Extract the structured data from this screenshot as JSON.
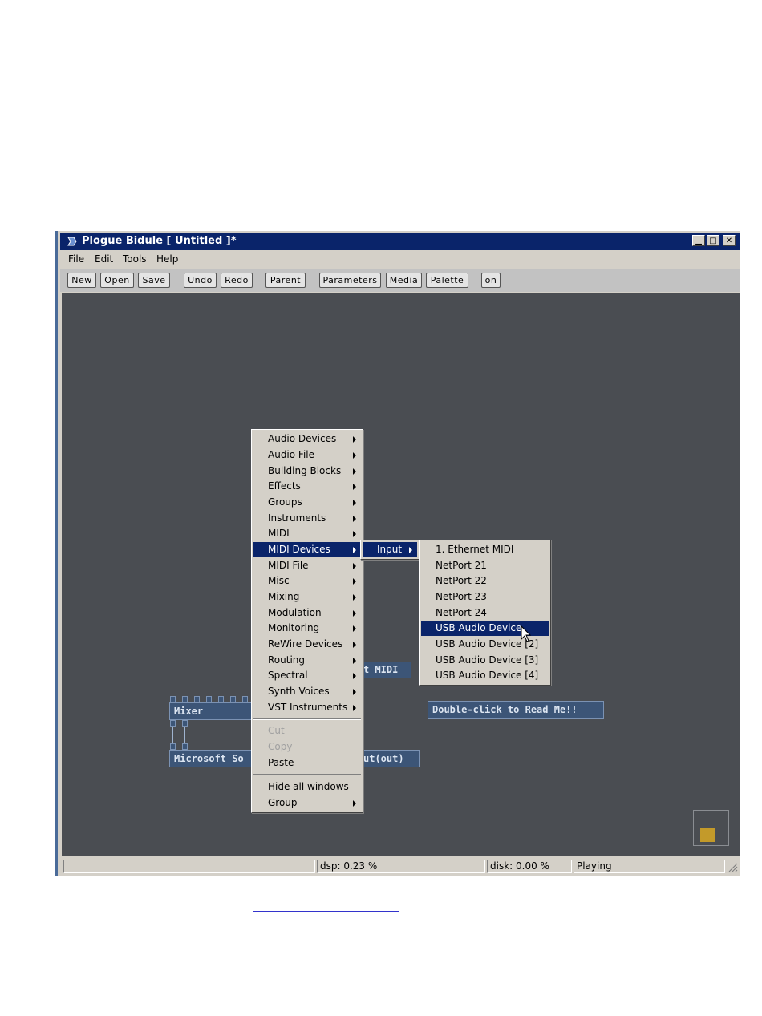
{
  "window": {
    "title": "Plogue Bidule [ Untitled ]*"
  },
  "menubar": [
    "File",
    "Edit",
    "Tools",
    "Help"
  ],
  "toolbar": [
    "New",
    "Open",
    "Save",
    "Undo",
    "Redo",
    "Parent",
    "Parameters",
    "Media",
    "Palette",
    "on"
  ],
  "canvas": {
    "nodes": {
      "midi_partial": "t MIDI",
      "readme": "Double-click to Read Me!!",
      "mixer": "Mixer",
      "ms_sound": "Microsoft So",
      "out_partial": "ut(out)"
    }
  },
  "context_menu": {
    "items": [
      "Audio Devices",
      "Audio File",
      "Building Blocks",
      "Effects",
      "Groups",
      "Instruments",
      "MIDI",
      "MIDI Devices",
      "MIDI File",
      "Misc",
      "Mixing",
      "Modulation",
      "Monitoring",
      "ReWire Devices",
      "Routing",
      "Spectral",
      "Synth Voices",
      "VST Instruments"
    ],
    "selected": "MIDI Devices",
    "edit_items": [
      "Cut",
      "Copy",
      "Paste"
    ],
    "extra_items": [
      "Hide all windows",
      "Group"
    ]
  },
  "submenu": {
    "items": [
      "Input"
    ]
  },
  "subsubmenu": {
    "items": [
      "1. Ethernet MIDI",
      "NetPort 21",
      "NetPort 22",
      "NetPort 23",
      "NetPort 24",
      "USB Audio Device",
      "USB Audio Device [2]",
      "USB Audio Device [3]",
      "USB Audio Device [4]"
    ],
    "selected": "USB Audio Device"
  },
  "statusbar": {
    "dsp": "dsp:  0.23 %",
    "disk": "disk:  0.00 %",
    "state": "Playing"
  },
  "colors": {
    "title_bg": "#0a246a",
    "canvas_bg": "#4a4d52",
    "highlight": "#0a246a",
    "node_bg": "#3c5577",
    "palette_square": "#c39a2a"
  }
}
